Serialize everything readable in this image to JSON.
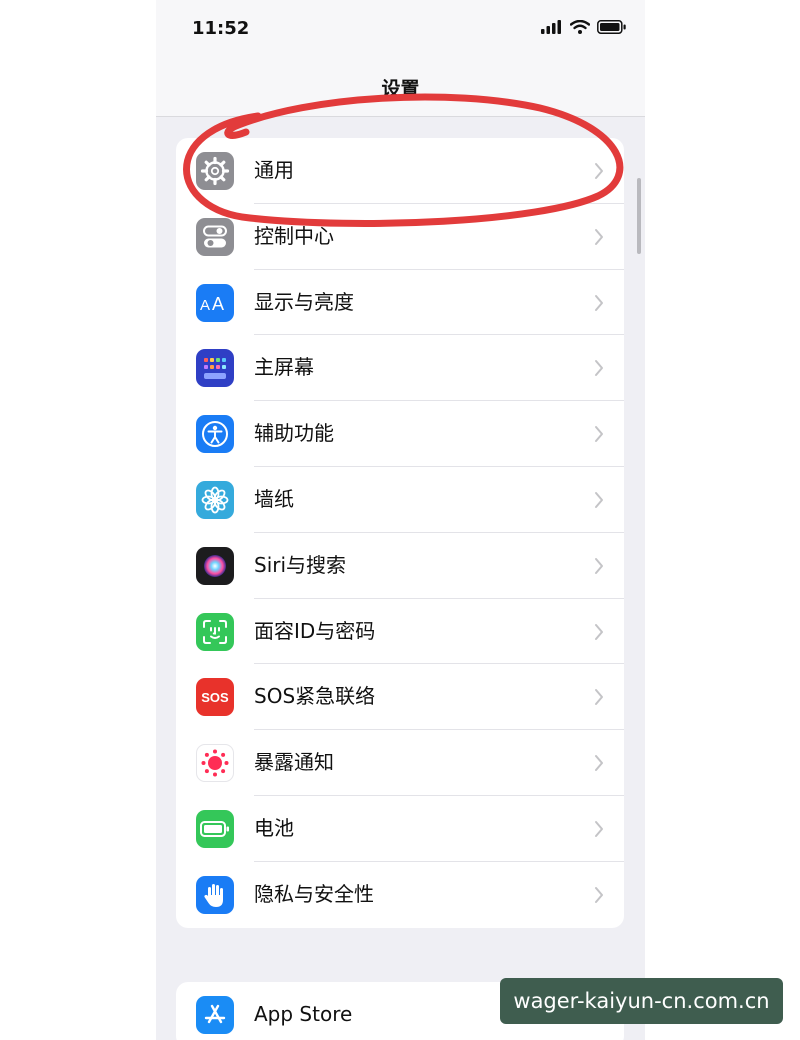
{
  "status_bar": {
    "time": "11:52",
    "icons": [
      "signal-icon",
      "wifi-icon",
      "battery-icon"
    ]
  },
  "nav": {
    "title": "设置"
  },
  "settings_group": {
    "items": [
      {
        "label": "通用",
        "icon": "gear-icon",
        "icon_color": "#8e8e93"
      },
      {
        "label": "控制中心",
        "icon": "toggles-icon",
        "icon_color": "#8e8e93"
      },
      {
        "label": "显示与亮度",
        "icon": "text-size-icon",
        "icon_color": "#1a7cf5"
      },
      {
        "label": "主屏幕",
        "icon": "home-grid-icon",
        "icon_color": "#2f3fc5"
      },
      {
        "label": "辅助功能",
        "icon": "accessibility-icon",
        "icon_color": "#1a7cf5"
      },
      {
        "label": "墙纸",
        "icon": "wallpaper-flower-icon",
        "icon_color": "#35aadc"
      },
      {
        "label": "Siri与搜索",
        "icon": "siri-icon",
        "icon_color": "#1c1c1e"
      },
      {
        "label": "面容ID与密码",
        "icon": "face-id-icon",
        "icon_color": "#34c759"
      },
      {
        "label": "SOS紧急联络",
        "icon": "sos-icon",
        "icon_color": "#e8322b",
        "icon_text": "SOS"
      },
      {
        "label": "暴露通知",
        "icon": "exposure-icon",
        "icon_color": "#ffffff",
        "accent": "#ff2d55"
      },
      {
        "label": "电池",
        "icon": "battery-icon",
        "icon_color": "#34c759"
      },
      {
        "label": "隐私与安全性",
        "icon": "hand-icon",
        "icon_color": "#1a7cf5"
      }
    ]
  },
  "store_group": {
    "items": [
      {
        "label": "App Store",
        "icon": "app-store-icon",
        "icon_color": "#1a8cf5"
      }
    ]
  },
  "annotation": {
    "color": "#e23b3b",
    "target": "通用"
  },
  "watermark": {
    "text": "wager-kaiyun-cn.com.cn"
  }
}
